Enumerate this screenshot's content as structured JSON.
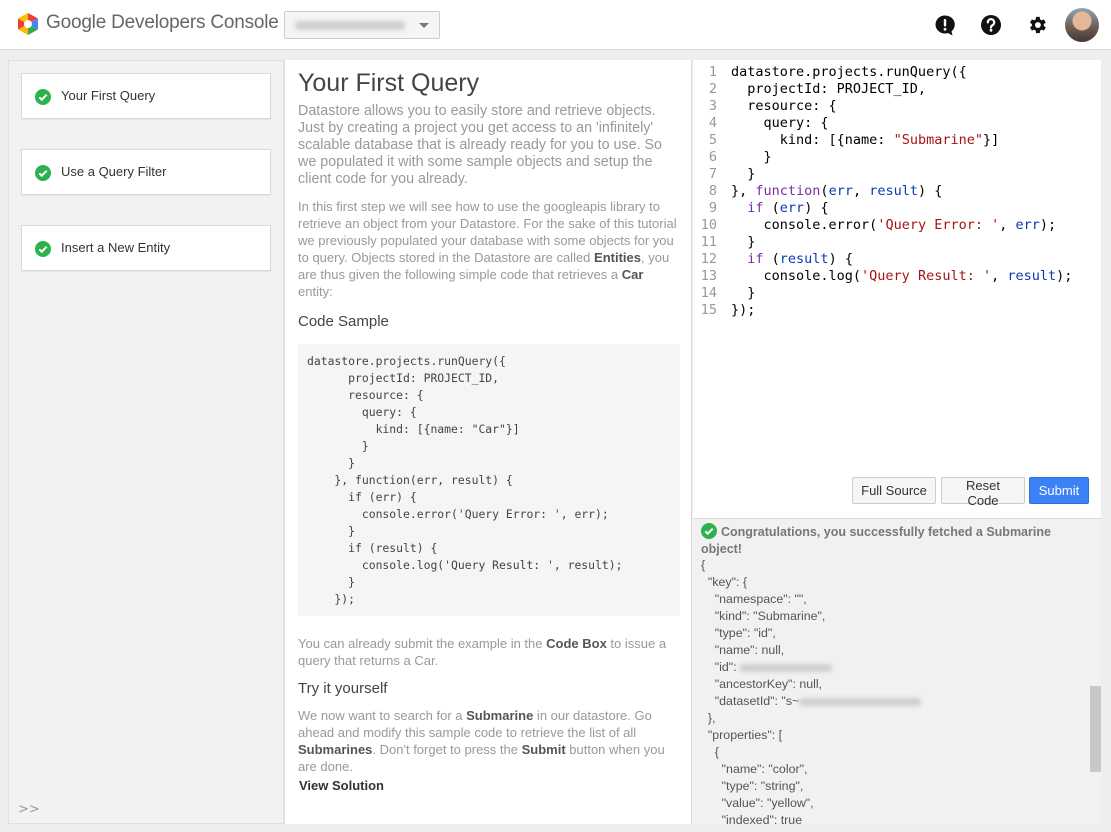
{
  "header": {
    "brand": "Google Developers Console",
    "project_selector": "",
    "icons": [
      "feedback-icon",
      "help-icon",
      "settings-icon",
      "avatar"
    ]
  },
  "steps": [
    {
      "label": "Your First Query",
      "status": "done"
    },
    {
      "label": "Use a Query Filter",
      "status": "done"
    },
    {
      "label": "Insert a New Entity",
      "status": "done"
    }
  ],
  "sidebar_toggle": ">>",
  "tutorial": {
    "title": "Your First Query",
    "lead": "Datastore allows you to easily store and retrieve objects. Just by creating a project you get access to an 'infinitely' scalable database that is already ready for you to use. So we populated it with some sample objects and setup the client code for you already.",
    "p1_a": "In this first step we will see how to use the googleapis library to retrieve an object from your Datastore. For the sake of this tutorial we previously populated your database with some objects for you to query. Objects stored in the Datastore are called ",
    "p1_b": "Entities",
    "p1_c": ", you are thus given the following simple code that retrieves a ",
    "p1_d": "Car",
    "p1_e": " entity:",
    "code_heading": "Code Sample",
    "code_sample": "datastore.projects.runQuery({\n      projectId: PROJECT_ID,\n      resource: {\n        query: {\n          kind: [{name: \"Car\"}]\n        }\n      }\n    }, function(err, result) {\n      if (err) {\n        console.error('Query Error: ', err);\n      }\n      if (result) {\n        console.log('Query Result: ', result);\n      }\n    });",
    "p2_a": "You can already submit the example in the ",
    "p2_b": "Code Box",
    "p2_c": " to issue a query that returns a Car.",
    "try_heading": "Try it yourself",
    "p3_a": "We now want to search for a ",
    "p3_b": "Submarine",
    "p3_c": " in our datastore. Go ahead and modify this sample code to retrieve the list of all ",
    "p3_d": "Submarines",
    "p3_e": ". Don't forget to press the ",
    "p3_f": "Submit",
    "p3_g": " button when you are done.",
    "view_solution": "View Solution"
  },
  "editor": {
    "line_numbers": [
      "1",
      "2",
      "3",
      "4",
      "5",
      "6",
      "7",
      "8",
      "9",
      "10",
      "11",
      "12",
      "13",
      "14",
      "15"
    ],
    "buttons": {
      "full_source": "Full Source",
      "reset_code": "Reset Code",
      "submit": "Submit"
    }
  },
  "result": {
    "message": "Congratulations, you successfully fetched a Submarine object!",
    "json_lines": [
      "{",
      "  \"key\": {",
      "    \"namespace\": \"\",",
      "    \"kind\": \"Submarine\",",
      "    \"type\": \"id\",",
      "    \"name\": null,",
      "    \"id\": ",
      "    \"ancestorKey\": null,",
      "    \"datasetId\": \"s~",
      "  },",
      "  \"properties\": [",
      "    {",
      "      \"name\": \"color\",",
      "      \"type\": \"string\",",
      "      \"value\": \"yellow\",",
      "      \"indexed\": true"
    ]
  },
  "colors": {
    "accent": "#3b82f6",
    "check_green": "#2bb24c"
  }
}
